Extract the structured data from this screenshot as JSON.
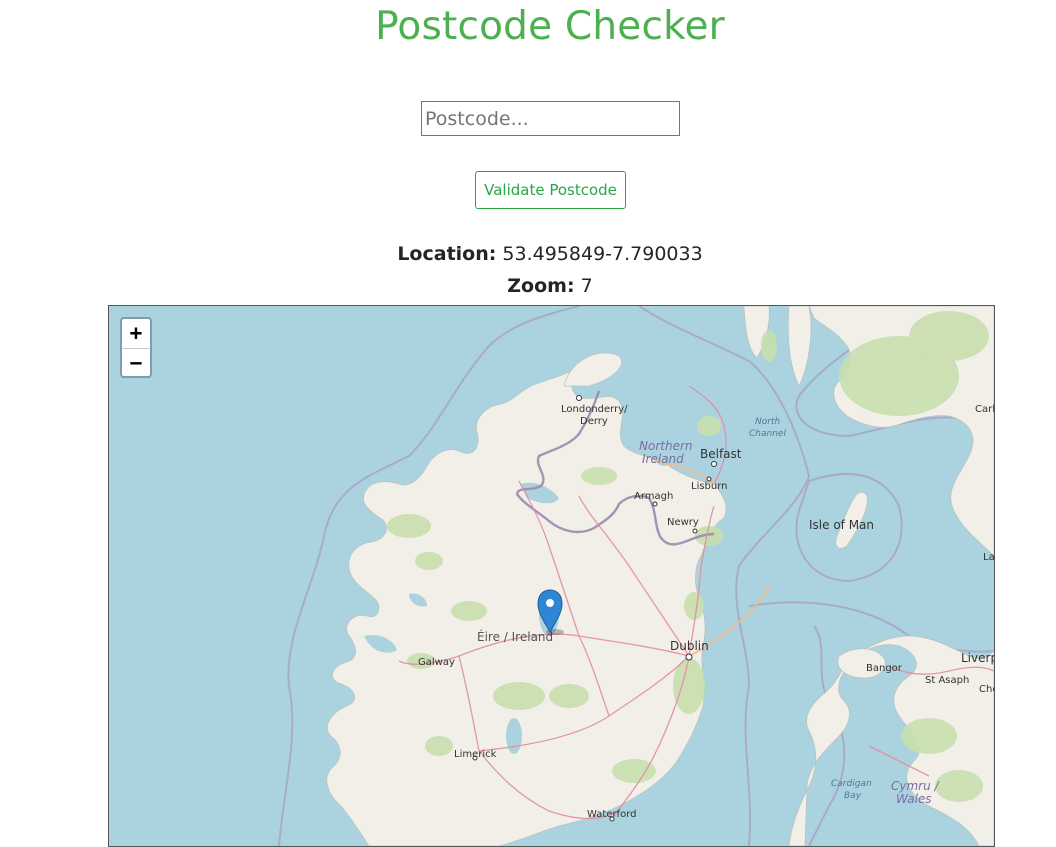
{
  "page": {
    "title": "Postcode Checker"
  },
  "form": {
    "postcode_placeholder": "Postcode...",
    "postcode_value": "",
    "validate_label": "Validate Postcode"
  },
  "info": {
    "location_label": "Location:",
    "location_value": "53.495849-7.790033",
    "zoom_label": "Zoom:",
    "zoom_value": "7"
  },
  "map": {
    "zoom_in_label": "+",
    "zoom_out_label": "−",
    "marker_icon": "map-pin-icon",
    "colors": {
      "sea": "#aad3df",
      "land": "#f2efe9",
      "forest": "#c8dfae",
      "border": "#a08fb0",
      "road": "#e38ca3",
      "marker": "#2e86d4"
    },
    "labels": {
      "londonderry": "Londonderry/",
      "derry": "Derry",
      "northern": "Northern",
      "ireland_ni": "Ireland",
      "belfast": "Belfast",
      "lisburn": "Lisburn",
      "armagh": "Armagh",
      "newry": "Newry",
      "north": "North",
      "channel": "Channel",
      "isle_of_man": "Isle of Man",
      "eire": "Éire / Ireland",
      "galway": "Galway",
      "dublin": "Dublin",
      "limerick": "Limerick",
      "waterford": "Waterford",
      "bangor": "Bangor",
      "st_asaph": "St Asaph",
      "liverpool_cut": "Liverp",
      "cardigan": "Cardigan",
      "bay": "Bay",
      "cymru": "Cymru /",
      "wales": "Wales",
      "carl_cut": "Carl",
      "la_cut": "La",
      "che_cut": "Che"
    }
  }
}
